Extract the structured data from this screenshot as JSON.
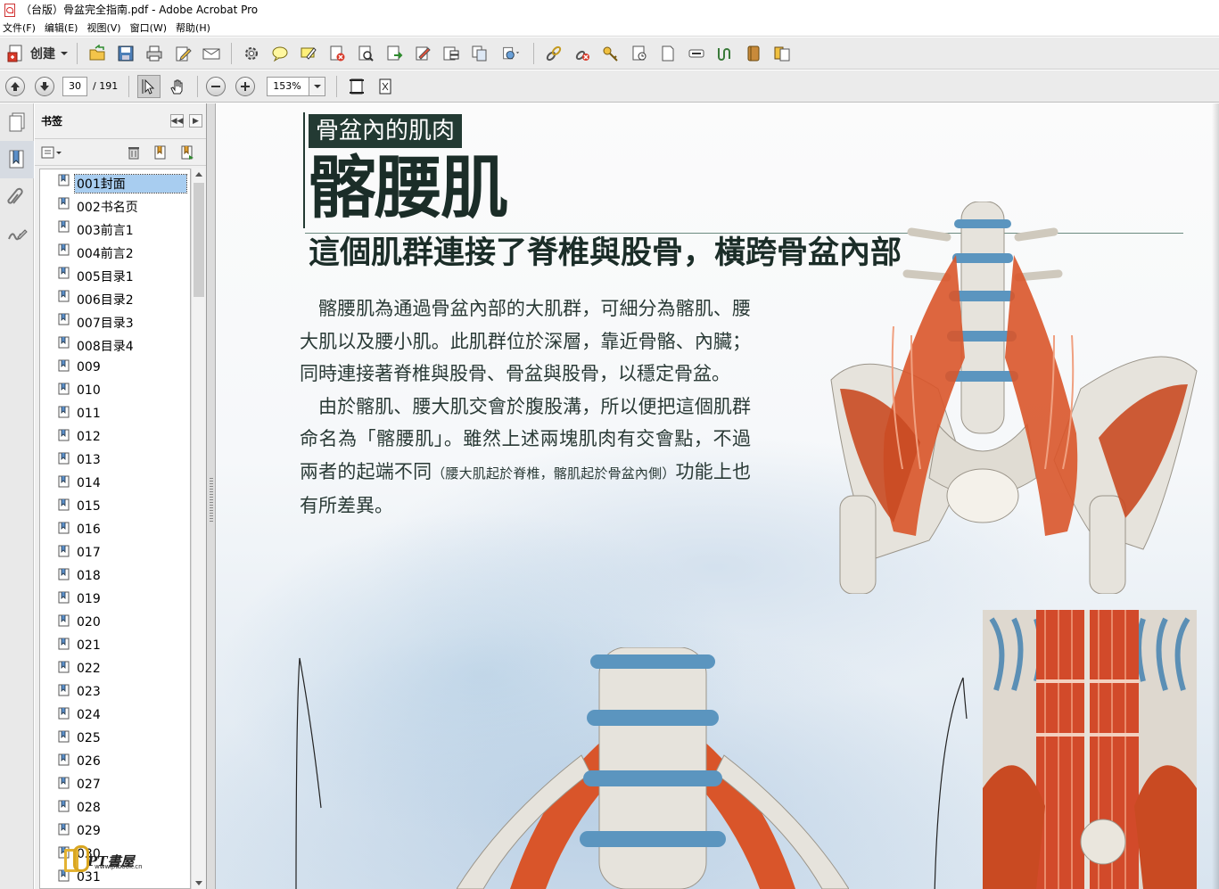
{
  "window": {
    "title": "（台版）骨盆完全指南.pdf - Adobe Acrobat Pro"
  },
  "menu": {
    "items": [
      "文件(F)",
      "编辑(E)",
      "视图(V)",
      "窗口(W)",
      "帮助(H)"
    ]
  },
  "toolbar": {
    "create_label": "创建"
  },
  "nav": {
    "current_page": "30",
    "total_pages": "/ 191",
    "zoom": "153%"
  },
  "bookmarks": {
    "title": "书签",
    "items": [
      "001封面",
      "002书名页",
      "003前言1",
      "004前言2",
      "005目录1",
      "006目录2",
      "007目录3",
      "008目录4",
      "009",
      "010",
      "011",
      "012",
      "013",
      "014",
      "015",
      "016",
      "017",
      "018",
      "019",
      "020",
      "021",
      "022",
      "023",
      "024",
      "025",
      "026",
      "027",
      "028",
      "029",
      "030",
      "031"
    ],
    "selected_index": 0
  },
  "watermark": {
    "name": "PT書屋",
    "url": "www.ptbook.cn"
  },
  "page": {
    "section_tag": "骨盆內的肌肉",
    "title": "髂腰肌",
    "subtitle": "這個肌群連接了脊椎與股骨，橫跨骨盆內部",
    "paragraph1": "髂腰肌為通過骨盆內部的大肌群，可細分為髂肌、腰大肌以及腰小肌。此肌群位於深層，靠近骨骼、內臟；同時連接著脊椎與股骨、骨盆與股骨，以穩定骨盆。",
    "paragraph2_main": "由於髂肌、腰大肌交會於腹股溝，所以便把這個肌群命名為「髂腰肌」。雖然上述兩塊肌肉有交會點，不過兩者的起端不同",
    "paragraph2_note": "（腰大肌起於脊椎，髂肌起於骨盆內側）",
    "paragraph2_end": "功能上也有所差異。"
  },
  "colors": {
    "accent_dark": "#233a33",
    "muscle": "#d9552a",
    "bone": "#e6e3dc",
    "disc": "#5b95bf",
    "selection": "#a8cdf0"
  }
}
